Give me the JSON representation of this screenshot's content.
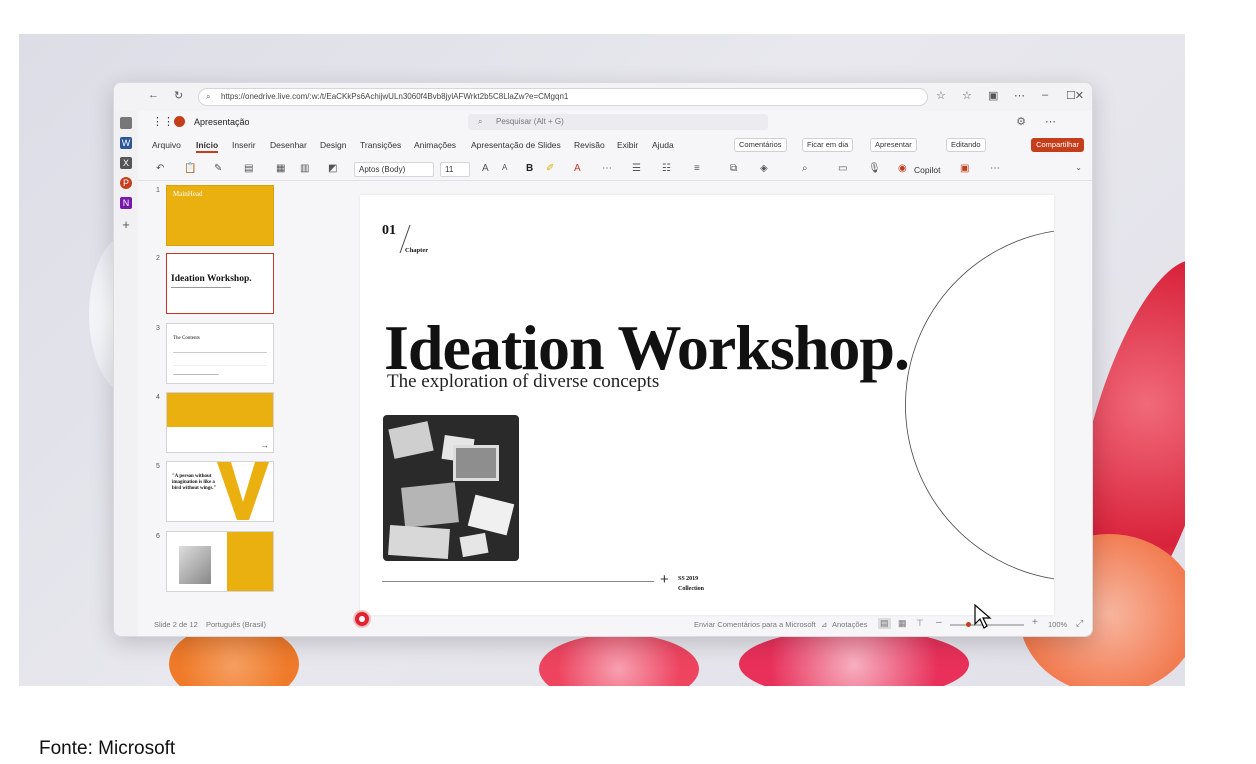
{
  "browser": {
    "url": "https://onedrive.live.com/:w:/t/EaCKkPs6AchijwULn3060f4Bvb8jylAFWrkt2b5C8LlaZw?e=CMgqn1"
  },
  "app": {
    "name": "Apresentação",
    "search_placeholder": "Pesquisar (Alt + G)"
  },
  "tabs": [
    "Arquivo",
    "Início",
    "Inserir",
    "Desenhar",
    "Design",
    "Transições",
    "Animações",
    "Apresentação de Slides",
    "Revisão",
    "Exibir",
    "Ajuda"
  ],
  "tab_buttons": {
    "comments": "Comentários",
    "catchup": "Ficar em dia",
    "present": "Apresentar",
    "editing": "Editando",
    "share": "Compartilhar"
  },
  "ribbon": {
    "font": "Aptos (Body)",
    "size": "11",
    "copilot": "Copilot"
  },
  "thumbnails": [
    {
      "num": "1",
      "title": "MainHead"
    },
    {
      "num": "2",
      "title": "Ideation Workshop."
    },
    {
      "num": "3",
      "title": "The Contents"
    },
    {
      "num": "4",
      "title": ""
    },
    {
      "num": "5",
      "title": "\"A person without imagination is like a bird without wings.\""
    },
    {
      "num": "6",
      "title": ""
    }
  ],
  "slide": {
    "chapter_num": "01",
    "chapter_label": "Chapter",
    "title": "Ideation Workshop.",
    "subtitle": "The exploration of diverse concepts",
    "season": "SS 2019",
    "collection": "Collection"
  },
  "status": {
    "slide_counter": "Slide 2 de 12",
    "language": "Português (Brasil)",
    "feedback": "Enviar Comentários para a Microsoft",
    "notes": "Anotações",
    "zoom": "100%"
  },
  "caption": "Fonte: Microsoft",
  "colors": {
    "accent": "#c43e1c",
    "slide_yellow": "#e9b00f"
  }
}
